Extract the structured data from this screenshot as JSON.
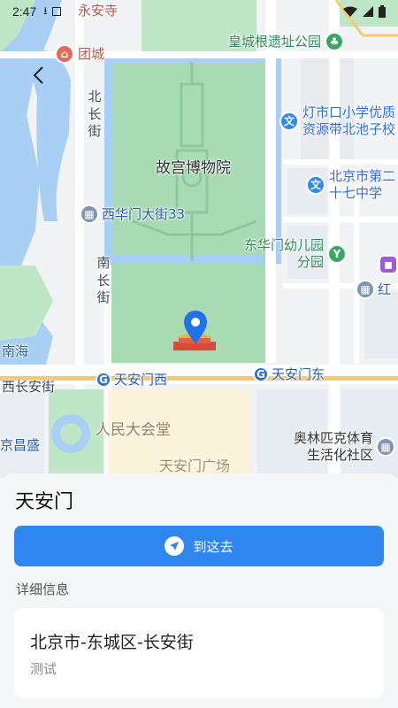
{
  "status_bar": {
    "time": "2:47"
  },
  "map": {
    "labels": {
      "yongan_temple": "永安寺",
      "tuancheng": "团城",
      "huangcheng_park": "皇城根遗址公园",
      "beichangjie": "北长街",
      "dengshikou_school": "灯市口小学优质资源带北池子校",
      "forbidden_city": "故宫博物院",
      "beijing_27_school": "北京市第二十七中学",
      "xihuamen_street": "西华门大街33",
      "nanchangjie": "南长街",
      "donghuamen_kindergarten": "东华门幼儿园分园",
      "hong": "红",
      "nanhai": "南海",
      "xichangan": "西长安街",
      "tiananmen_west": "天安门西",
      "tiananmen_east": "天安门东",
      "great_hall": "人民大会堂",
      "changsheng": "京昌盛",
      "olympic_center": "奥林匹克体育生活化社区",
      "tiananmen_square": "天安门广场"
    },
    "icons": {
      "back": "back-arrow-icon",
      "marker": "location-pin-icon",
      "subway": "subway-icon",
      "school": "school-icon",
      "park": "park-icon"
    }
  },
  "sheet": {
    "title": "天安门",
    "go_button_label": "到这去",
    "detail_header": "详细信息",
    "address": "北京市-东城区-长安街",
    "note": "测试"
  },
  "colors": {
    "accent": "#2f86ee",
    "park_green": "#a8dbb4",
    "water": "#a9cff5"
  }
}
